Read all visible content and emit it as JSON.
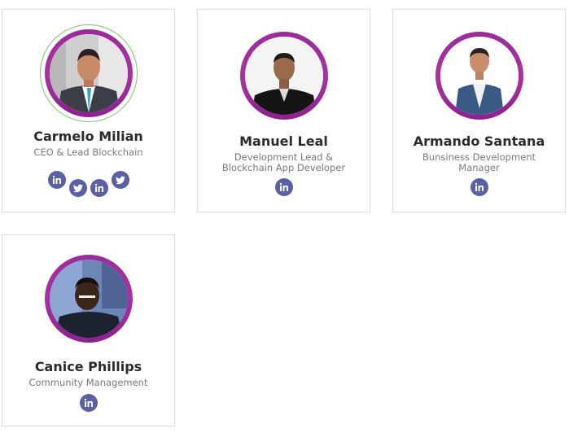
{
  "colors": {
    "ring": "#a02a9f",
    "social_bg": "#5a5fa6",
    "name_text": "#2b2b2b",
    "role_text": "#7a7a7a",
    "card_border": "#dcdcdc"
  },
  "team": [
    {
      "name": "Carmelo Milian",
      "role": "CEO & Lead Blockchain",
      "socials": [
        "linkedin-icon",
        "twitter-icon",
        "linkedin-icon",
        "twitter-icon"
      ]
    },
    {
      "name": "Manuel Leal",
      "role_line1": "Development Lead &",
      "role_line2": "Blockchain App Developer",
      "socials": [
        "linkedin-icon"
      ]
    },
    {
      "name": "Armando Santana",
      "role_line1": "Bunsiness Development",
      "role_line2": "Manager",
      "socials": [
        "linkedin-icon"
      ]
    },
    {
      "name": "Canice Phillips",
      "role": "Community Management",
      "socials": [
        "linkedin-icon"
      ]
    }
  ]
}
